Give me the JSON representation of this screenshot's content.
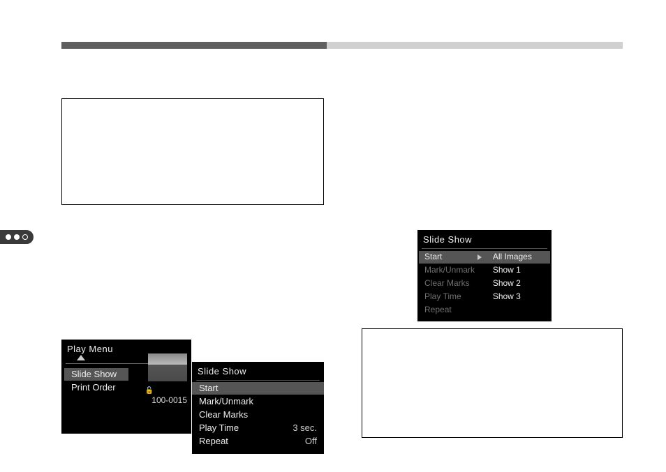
{
  "playMenu": {
    "title": "Play Menu",
    "items": [
      "Slide Show",
      "Print Order"
    ],
    "imageNumber": "100-0015"
  },
  "slideShowMenu": {
    "title": "Slide Show",
    "items": {
      "start": "Start",
      "mark": "Mark/Unmark",
      "clear": "Clear Marks",
      "playtime_label": "Play Time",
      "playtime_value": "3 sec.",
      "repeat_label": "Repeat",
      "repeat_value": "Off"
    }
  },
  "slideShowStart": {
    "title": "Slide Show",
    "left": {
      "start": "Start",
      "mark": "Mark/Unmark",
      "clear": "Clear Marks",
      "playtime": "Play Time",
      "repeat": "Repeat"
    },
    "right": {
      "all": "All Images",
      "s1": "Show 1",
      "s2": "Show 2",
      "s3": "Show 3"
    }
  }
}
